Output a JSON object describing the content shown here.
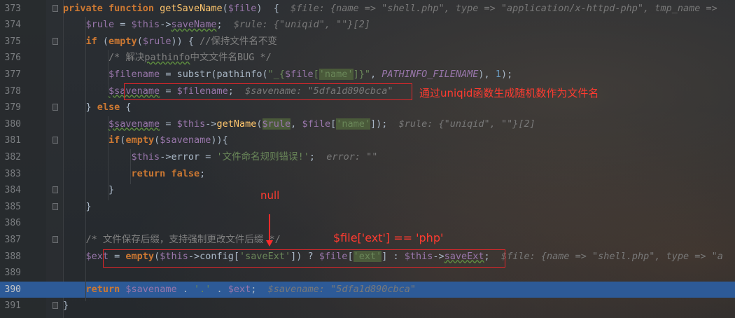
{
  "lines": [
    {
      "n": "373",
      "code": [
        {
          "c": "kw",
          "t": "private function "
        },
        {
          "c": "fn",
          "t": "getSaveName"
        },
        {
          "c": "",
          "t": "("
        },
        {
          "c": "var",
          "t": "$file"
        },
        {
          "c": "",
          "t": ")  {  "
        },
        {
          "c": "hint",
          "t": "$file: {name => \"shell.php\", type => \"application/x-httpd-php\", tmp_name =>"
        }
      ]
    },
    {
      "n": "374",
      "code": [
        {
          "c": "",
          "t": "    "
        },
        {
          "c": "var",
          "t": "$rule"
        },
        {
          "c": "",
          "t": " = "
        },
        {
          "c": "var",
          "t": "$this"
        },
        {
          "c": "",
          "t": "->"
        },
        {
          "c": "var ul",
          "t": "saveName"
        },
        {
          "c": "",
          "t": ";  "
        },
        {
          "c": "hint",
          "t": "$rule: {\"uniqid\", \"\"}[2]"
        }
      ]
    },
    {
      "n": "375",
      "code": [
        {
          "c": "",
          "t": "    "
        },
        {
          "c": "kw",
          "t": "if"
        },
        {
          "c": "",
          "t": " ("
        },
        {
          "c": "kw",
          "t": "empty"
        },
        {
          "c": "",
          "t": "("
        },
        {
          "c": "var",
          "t": "$rule"
        },
        {
          "c": "",
          "t": ")) { "
        },
        {
          "c": "cmt",
          "t": "//保持文件名不变"
        }
      ]
    },
    {
      "n": "376",
      "code": [
        {
          "c": "",
          "t": "        "
        },
        {
          "c": "cmt",
          "t": "/* 解决"
        },
        {
          "c": "cmt ul",
          "t": "pathinfo"
        },
        {
          "c": "cmt",
          "t": "中文文件名BUG */"
        }
      ]
    },
    {
      "n": "377",
      "code": [
        {
          "c": "",
          "t": "        "
        },
        {
          "c": "var",
          "t": "$filename"
        },
        {
          "c": "",
          "t": " = substr(pathinfo("
        },
        {
          "c": "str",
          "t": "\"_{"
        },
        {
          "c": "var",
          "t": "$file"
        },
        {
          "c": "str",
          "t": "["
        },
        {
          "c": "str hl",
          "t": "'name'"
        },
        {
          "c": "str",
          "t": "]}\""
        },
        {
          "c": "",
          "t": ", "
        },
        {
          "c": "const",
          "t": "PATHINFO_FILENAME"
        },
        {
          "c": "",
          "t": "), "
        },
        {
          "c": "num",
          "t": "1"
        },
        {
          "c": "",
          "t": ");"
        }
      ]
    },
    {
      "n": "378",
      "code": [
        {
          "c": "",
          "t": "        "
        },
        {
          "c": "var ul",
          "t": "$savename"
        },
        {
          "c": "",
          "t": " = "
        },
        {
          "c": "var",
          "t": "$filename"
        },
        {
          "c": "",
          "t": ";  "
        },
        {
          "c": "hint",
          "t": "$savename: \"5dfa1d890cbca\""
        }
      ]
    },
    {
      "n": "379",
      "code": [
        {
          "c": "",
          "t": "    } "
        },
        {
          "c": "kw",
          "t": "else"
        },
        {
          "c": "",
          "t": " {"
        }
      ]
    },
    {
      "n": "380",
      "code": [
        {
          "c": "",
          "t": "        "
        },
        {
          "c": "var ul",
          "t": "$savename"
        },
        {
          "c": "",
          "t": " = "
        },
        {
          "c": "var",
          "t": "$this"
        },
        {
          "c": "",
          "t": "->"
        },
        {
          "c": "fn",
          "t": "getName"
        },
        {
          "c": "",
          "t": "("
        },
        {
          "c": "var hl",
          "t": "$rule"
        },
        {
          "c": "",
          "t": ", "
        },
        {
          "c": "var",
          "t": "$file"
        },
        {
          "c": "",
          "t": "["
        },
        {
          "c": "str hl",
          "t": "'name'"
        },
        {
          "c": "",
          "t": "]);  "
        },
        {
          "c": "hint",
          "t": "$rule: {\"uniqid\", \"\"}[2]"
        }
      ]
    },
    {
      "n": "381",
      "code": [
        {
          "c": "",
          "t": "        "
        },
        {
          "c": "kw",
          "t": "if"
        },
        {
          "c": "",
          "t": "("
        },
        {
          "c": "kw",
          "t": "empty"
        },
        {
          "c": "",
          "t": "("
        },
        {
          "c": "var",
          "t": "$savename"
        },
        {
          "c": "",
          "t": ")){"
        }
      ]
    },
    {
      "n": "382",
      "code": [
        {
          "c": "",
          "t": "            "
        },
        {
          "c": "var",
          "t": "$this"
        },
        {
          "c": "",
          "t": "->error = "
        },
        {
          "c": "str",
          "t": "'文件命名规则错误!'"
        },
        {
          "c": "",
          "t": ";  "
        },
        {
          "c": "hint",
          "t": "error: \"\""
        }
      ]
    },
    {
      "n": "383",
      "code": [
        {
          "c": "",
          "t": "            "
        },
        {
          "c": "kw",
          "t": "return false"
        },
        {
          "c": "",
          "t": ";"
        }
      ]
    },
    {
      "n": "384",
      "code": [
        {
          "c": "",
          "t": "        }"
        }
      ]
    },
    {
      "n": "385",
      "code": [
        {
          "c": "",
          "t": "    }"
        }
      ]
    },
    {
      "n": "386",
      "code": []
    },
    {
      "n": "387",
      "code": [
        {
          "c": "",
          "t": "    "
        },
        {
          "c": "cmt",
          "t": "/* 文件保存后缀，支持强制更改文件后缀 */"
        }
      ]
    },
    {
      "n": "388",
      "code": [
        {
          "c": "",
          "t": "    "
        },
        {
          "c": "var",
          "t": "$ext"
        },
        {
          "c": "",
          "t": " = "
        },
        {
          "c": "kw",
          "t": "empty"
        },
        {
          "c": "",
          "t": "("
        },
        {
          "c": "var",
          "t": "$this"
        },
        {
          "c": "",
          "t": "->config["
        },
        {
          "c": "str",
          "t": "'saveExt'"
        },
        {
          "c": "",
          "t": "]) ? "
        },
        {
          "c": "var",
          "t": "$file"
        },
        {
          "c": "",
          "t": "["
        },
        {
          "c": "str hl",
          "t": "'ext'"
        },
        {
          "c": "",
          "t": "] : "
        },
        {
          "c": "var",
          "t": "$this"
        },
        {
          "c": "",
          "t": "->"
        },
        {
          "c": "var ul",
          "t": "saveExt"
        },
        {
          "c": "",
          "t": ";  "
        },
        {
          "c": "hint",
          "t": "$file: {name => \"shell.php\", type => \"a"
        }
      ]
    },
    {
      "n": "389",
      "code": []
    },
    {
      "n": "390",
      "code": [
        {
          "c": "",
          "t": "    "
        },
        {
          "c": "kw",
          "t": "return "
        },
        {
          "c": "var",
          "t": "$savename"
        },
        {
          "c": "",
          "t": " . "
        },
        {
          "c": "str",
          "t": "'.'"
        },
        {
          "c": "",
          "t": " . "
        },
        {
          "c": "var",
          "t": "$ext"
        },
        {
          "c": "",
          "t": ";  "
        },
        {
          "c": "hint",
          "t": "$savename: \"5dfa1d890cbca\""
        }
      ]
    },
    {
      "n": "391",
      "code": [
        {
          "c": "",
          "t": "}"
        }
      ]
    }
  ],
  "current_line": "390",
  "annotations": {
    "uniqid_note": "通过uniqid函数生成随机数作为文件名",
    "null_note": "null",
    "ext_note": "$file['ext'] == 'php'"
  },
  "colors": {
    "annotation": "#ff3b30",
    "current_line_bg": "#2d5a97",
    "keyword": "#cc7832",
    "variable": "#9876aa",
    "string": "#6a8759",
    "function": "#ffc66d"
  }
}
